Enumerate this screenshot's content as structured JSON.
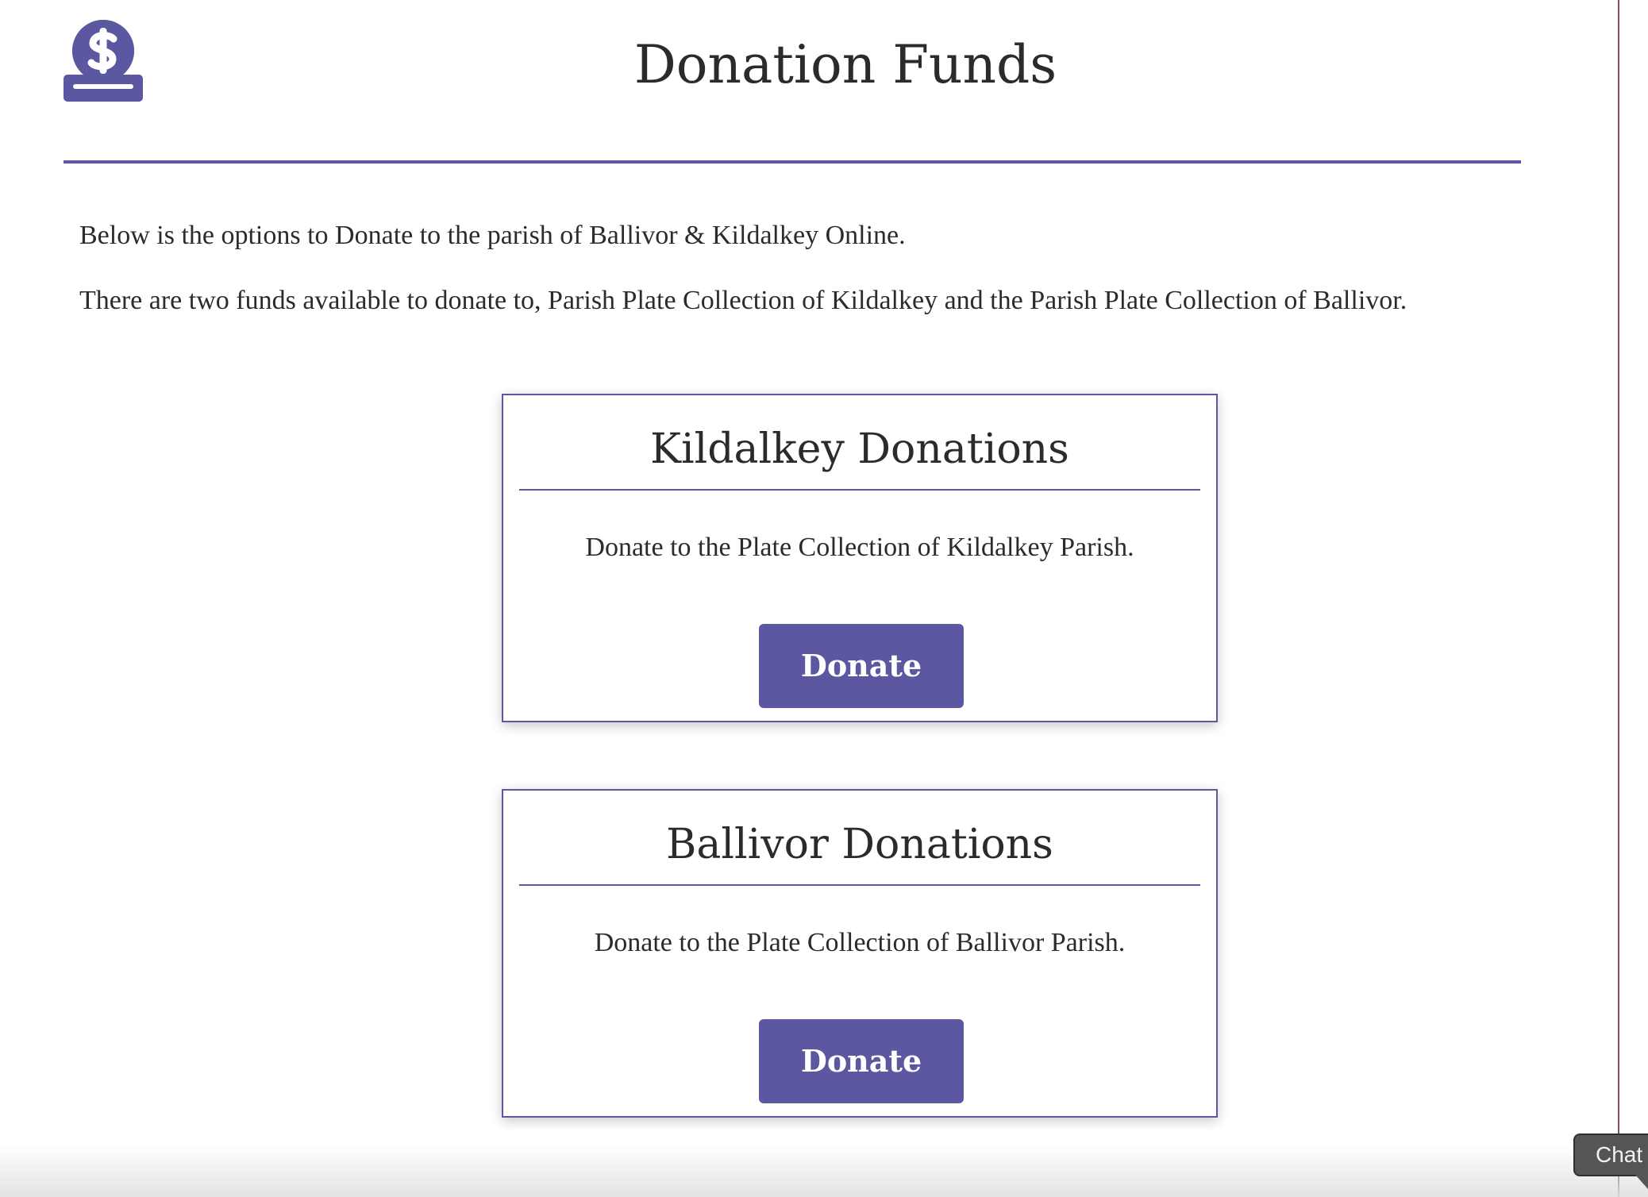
{
  "header": {
    "title": "Donation Funds",
    "logo_icon": "dollar-coin-donation-icon",
    "accent_color": "#5b57a0"
  },
  "intro": {
    "paragraph_1": "Below is the options to Donate to the parish of Ballivor & Kildalkey Online.",
    "paragraph_2": "There are two funds available to donate to, Parish Plate Collection of Kildalkey and the Parish Plate Collection of Ballivor."
  },
  "funds": [
    {
      "title": "Kildalkey Donations",
      "description": "Donate to the Plate Collection of Kildalkey Parish.",
      "button_label": "Donate"
    },
    {
      "title": "Ballivor Donations",
      "description": "Donate to the Plate Collection of Ballivor Parish.",
      "button_label": "Donate"
    }
  ],
  "chat_widget": {
    "label": "Chat"
  }
}
